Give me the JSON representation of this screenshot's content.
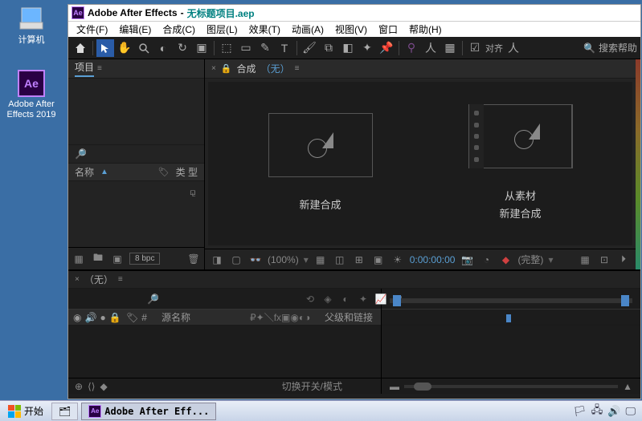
{
  "desktop": {
    "computer": "计算机",
    "ae_icon": "Adobe After Effects 2019"
  },
  "titlebar": {
    "app": "Adobe After Effects",
    "dash": " - ",
    "file": "无标题项目.aep"
  },
  "menu": {
    "file": "文件(F)",
    "edit": "编辑(E)",
    "comp": "合成(C)",
    "layer": "图层(L)",
    "effect": "效果(T)",
    "anim": "动画(A)",
    "view": "视图(V)",
    "window": "窗口",
    "help": "帮助(H)"
  },
  "toolbar": {
    "snap_label": "对齐",
    "search_placeholder": "搜索帮助"
  },
  "project": {
    "title": "项目",
    "col_name": "名称",
    "col_type": "类 型",
    "bpc": "8 bpc",
    "search_placeholder": ""
  },
  "composition": {
    "tab_label": "合成",
    "tab_none": "（无）",
    "tile_new": "新建合成",
    "tile_from_label1": "从素材",
    "tile_from_label2": "新建合成",
    "foot_percent": "(100%)",
    "foot_timecode": "0:00:00:00",
    "foot_quality": "(完整)"
  },
  "timeline": {
    "tab": "（无）",
    "col_src": "源名称",
    "col_parent": "父级和链接",
    "toggle_label": "切换开关/模式"
  },
  "taskbar": {
    "start": "开始",
    "app": "Adobe After Eff..."
  }
}
